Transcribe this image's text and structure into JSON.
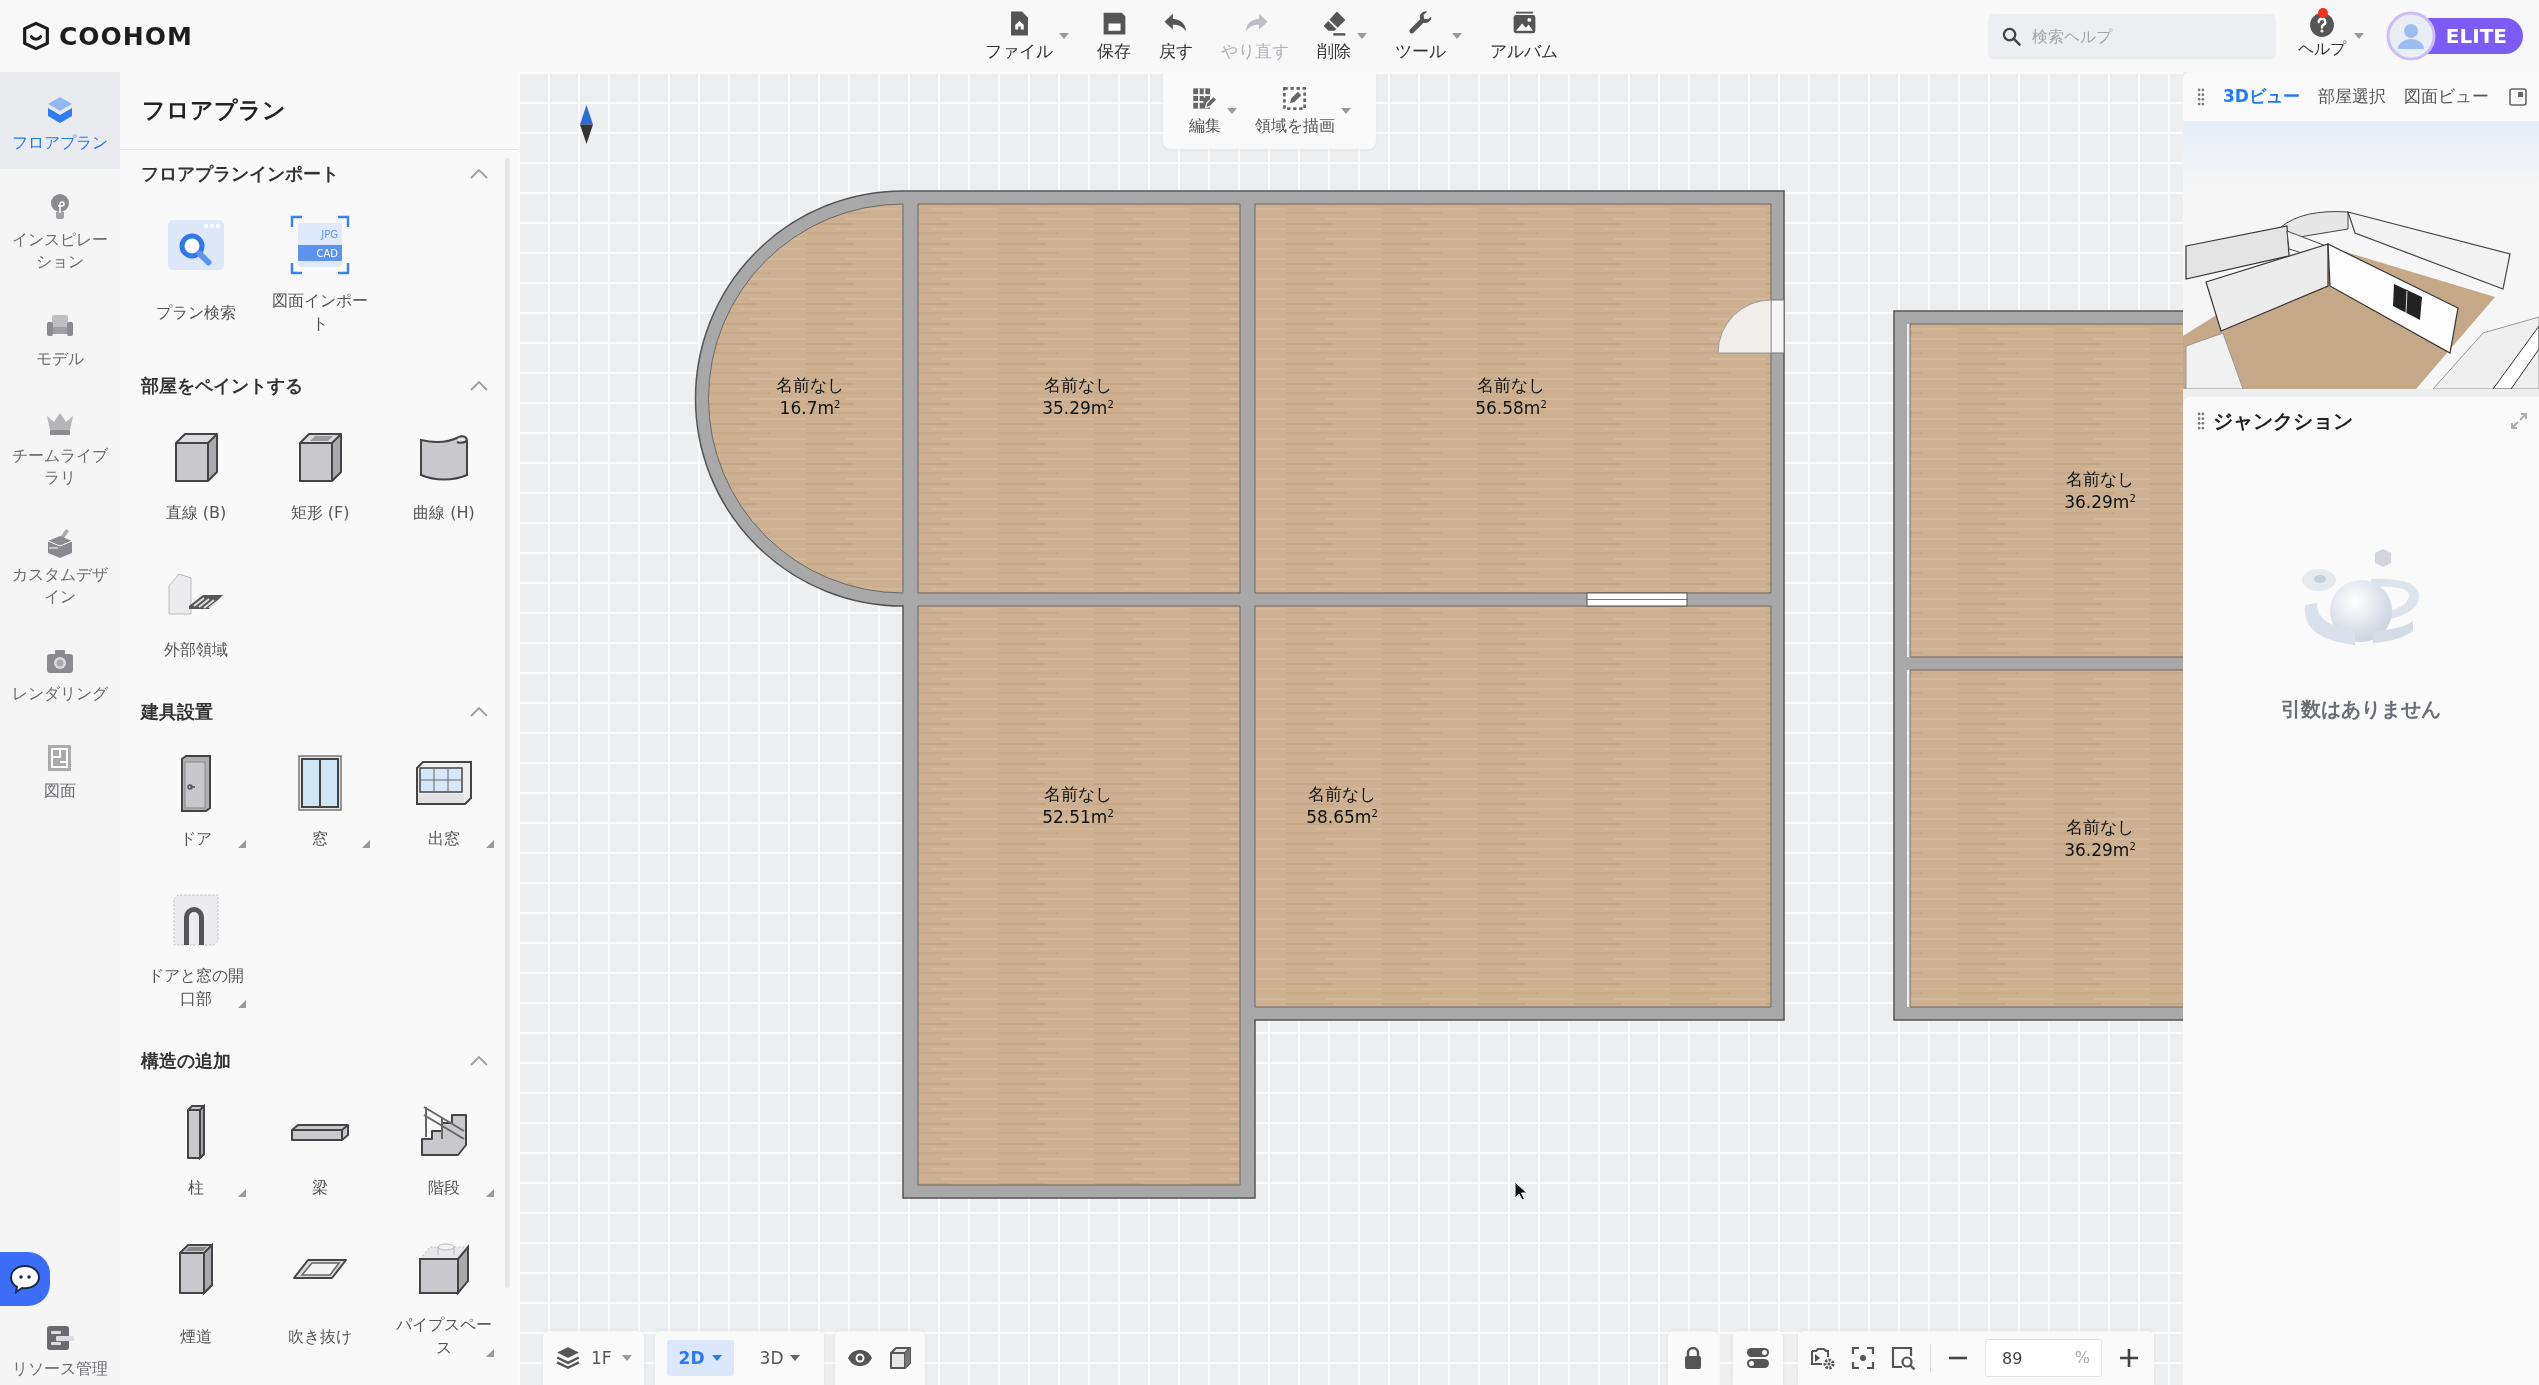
{
  "app": {
    "logo": "COOHOM"
  },
  "toolbar": {
    "items": [
      {
        "label": "ファイル",
        "has_menu": true,
        "disabled": false
      },
      {
        "label": "保存",
        "has_menu": false,
        "disabled": false
      },
      {
        "label": "戻す",
        "has_menu": false,
        "disabled": false
      },
      {
        "label": "やり直す",
        "has_menu": false,
        "disabled": true
      },
      {
        "label": "削除",
        "has_menu": true,
        "disabled": false
      },
      {
        "label": "ツール",
        "has_menu": true,
        "disabled": false
      },
      {
        "label": "アルバム",
        "has_menu": false,
        "disabled": false
      }
    ]
  },
  "search": {
    "placeholder": "検索ヘルプ"
  },
  "help": {
    "label": "ヘルプ",
    "has_menu": true,
    "notification": true
  },
  "account": {
    "badge": "ELITE"
  },
  "nav_rail": {
    "items": [
      {
        "label": "フロアプラン",
        "selected": true
      },
      {
        "label": "インスピレーション",
        "selected": false
      },
      {
        "label": "モデル",
        "selected": false
      },
      {
        "label": "チームライブラリ",
        "selected": false
      },
      {
        "label": "カスタムデザイン",
        "selected": false
      },
      {
        "label": "レンダリング",
        "selected": false
      },
      {
        "label": "図面",
        "selected": false
      }
    ],
    "footer_item": {
      "label": "リソース管理"
    }
  },
  "panel": {
    "title": "フロアプラン",
    "sections": [
      {
        "title": "フロアプランインポート",
        "expanded": true,
        "items": [
          {
            "label": "プラン検索",
            "has_options": false
          },
          {
            "label": "図面インポート",
            "has_options": false,
            "icon_texts": [
              "JPG",
              "CAD"
            ]
          }
        ]
      },
      {
        "title": "部屋をペイントする",
        "expanded": true,
        "items": [
          {
            "label": "直線 (B)",
            "has_options": false
          },
          {
            "label": "矩形 (F)",
            "has_options": false
          },
          {
            "label": "曲線 (H)",
            "has_options": false
          },
          {
            "label": "外部領域",
            "has_options": false
          }
        ]
      },
      {
        "title": "建具設置",
        "expanded": true,
        "items": [
          {
            "label": "ドア",
            "has_options": true
          },
          {
            "label": "窓",
            "has_options": true
          },
          {
            "label": "出窓",
            "has_options": true
          },
          {
            "label": "ドアと窓の開口部",
            "has_options": true
          }
        ]
      },
      {
        "title": "構造の追加",
        "expanded": true,
        "items": [
          {
            "label": "柱",
            "has_options": true
          },
          {
            "label": "梁",
            "has_options": false
          },
          {
            "label": "階段",
            "has_options": true
          },
          {
            "label": "煙道",
            "has_options": false
          },
          {
            "label": "吹き抜け",
            "has_options": false
          },
          {
            "label": "パイプスペース",
            "has_options": true
          }
        ]
      }
    ]
  },
  "edit_toolbar": {
    "items": [
      {
        "label": "編集",
        "has_menu": true
      },
      {
        "label": "領域を描画",
        "has_menu": true
      }
    ]
  },
  "floor_plan": {
    "rooms": [
      {
        "name": "名前なし",
        "area": "16.7m$^{2}$"
      },
      {
        "name": "名前なし",
        "area": "35.29m$^{2}$"
      },
      {
        "name": "名前なし",
        "area": "56.58m$^{2}$"
      },
      {
        "name": "名前なし",
        "area": "52.51m$^{2}$"
      },
      {
        "name": "名前なし",
        "area": "58.65m$^{2}$"
      },
      {
        "name": "名前なし",
        "area": "36.29m$^{2}$"
      },
      {
        "name": "名前なし",
        "area": "36.29m$^{2}$"
      }
    ]
  },
  "view_panel": {
    "tabs": [
      {
        "label": "3Dビュー",
        "selected": true
      },
      {
        "label": "部屋選択",
        "selected": false
      },
      {
        "label": "図面ビュー",
        "selected": false
      }
    ]
  },
  "junction_panel": {
    "title": "ジャンクション",
    "empty_message": "引数はありません"
  },
  "bottom_bar": {
    "floor": "1F",
    "view_modes": [
      {
        "label": "2D",
        "selected": true
      },
      {
        "label": "3D",
        "selected": false
      }
    ],
    "zoom": {
      "value": "89",
      "unit": "%"
    }
  }
}
